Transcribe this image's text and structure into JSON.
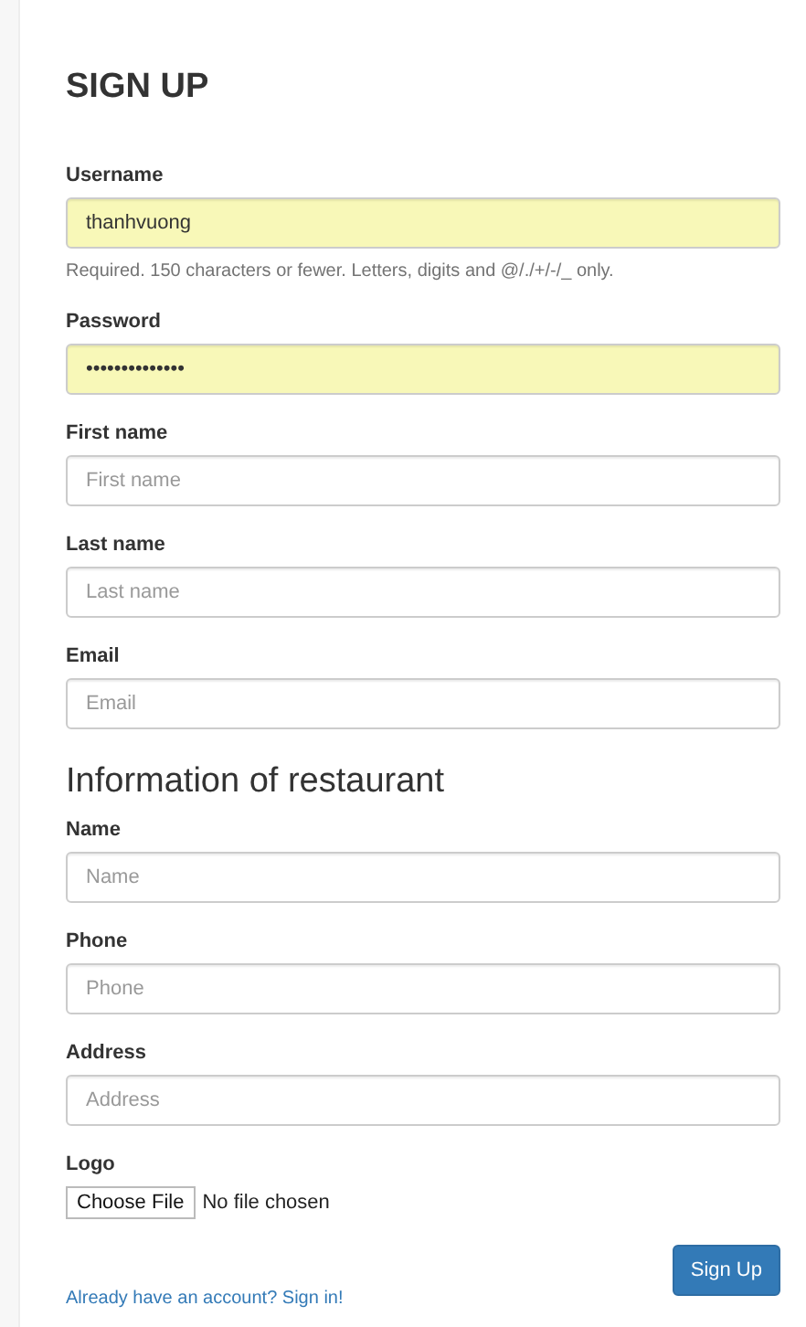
{
  "title": "SIGN UP",
  "account_fields": [
    {
      "label": "Username",
      "value": "thanhvuong",
      "autofilled": true,
      "help": "Required. 150 characters or fewer. Letters, digits and @/./+/-/_ only."
    },
    {
      "label": "Password",
      "value": "••••••••••••••",
      "autofilled": true
    },
    {
      "label": "First name",
      "placeholder": "First name",
      "autofilled": false
    },
    {
      "label": "Last name",
      "placeholder": "Last name",
      "autofilled": false
    },
    {
      "label": "Email",
      "placeholder": "Email",
      "autofilled": false
    }
  ],
  "restaurant_heading": "Information of restaurant",
  "restaurant_fields": [
    {
      "label": "Name",
      "placeholder": "Name",
      "autofilled": false
    },
    {
      "label": "Phone",
      "placeholder": "Phone",
      "autofilled": false
    },
    {
      "label": "Address",
      "placeholder": "Address",
      "autofilled": false
    }
  ],
  "logo": {
    "label": "Logo",
    "button": "Choose File",
    "status": "No file chosen"
  },
  "submit": "Sign Up",
  "signin_link": "Already have an account? Sign in!"
}
